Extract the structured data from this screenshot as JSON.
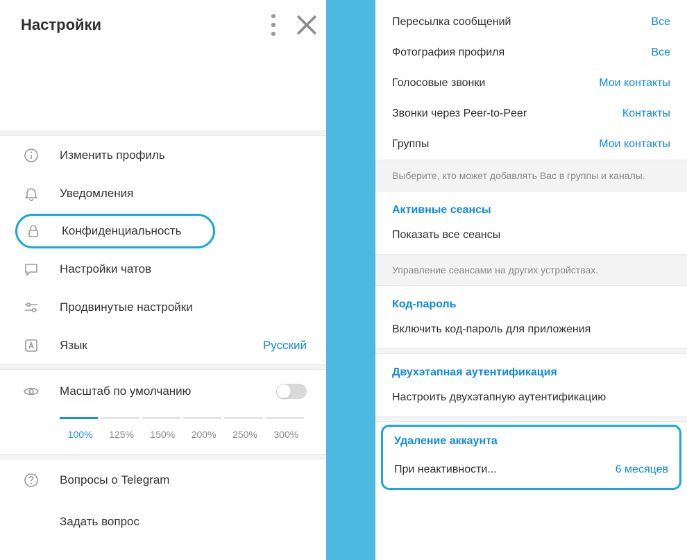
{
  "header": {
    "title": "Настройки"
  },
  "menu": {
    "edit_profile": "Изменить профиль",
    "notifications": "Уведомления",
    "privacy": "Конфиденциальность",
    "chat_settings": "Настройки чатов",
    "advanced": "Продвинутые настройки",
    "language_label": "Язык",
    "language_value": "Русский"
  },
  "scale": {
    "label": "Масштаб по умолчанию",
    "values": [
      "100%",
      "125%",
      "150%",
      "200%",
      "250%",
      "300%"
    ],
    "active_index": 0
  },
  "help": {
    "faq": "Вопросы о Telegram",
    "ask": "Задать вопрос"
  },
  "privacy_panel": {
    "rows": [
      {
        "label": "Пересылка сообщений",
        "value": "Все"
      },
      {
        "label": "Фотография профиля",
        "value": "Все"
      },
      {
        "label": "Голосовые звонки",
        "value": "Мои контакты"
      },
      {
        "label": "Звонки через Peer-to-Peer",
        "value": "Контакты"
      },
      {
        "label": "Группы",
        "value": "Мои контакты"
      }
    ],
    "groups_note": "Выберите, кто может добавлять Вас в группы и каналы.",
    "sessions_title": "Активные сеансы",
    "sessions_action": "Показать все сеансы",
    "sessions_note": "Управление сеансами на других устройствах.",
    "passcode_title": "Код-пароль",
    "passcode_action": "Включить код-пароль для приложения",
    "twostep_title": "Двухэтапная аутентификация",
    "twostep_action": "Настроить двухэтапную аутентификацию",
    "delete_title": "Удаление аккаунта",
    "delete_label": "При неактивности...",
    "delete_value": "6 месяцев"
  }
}
